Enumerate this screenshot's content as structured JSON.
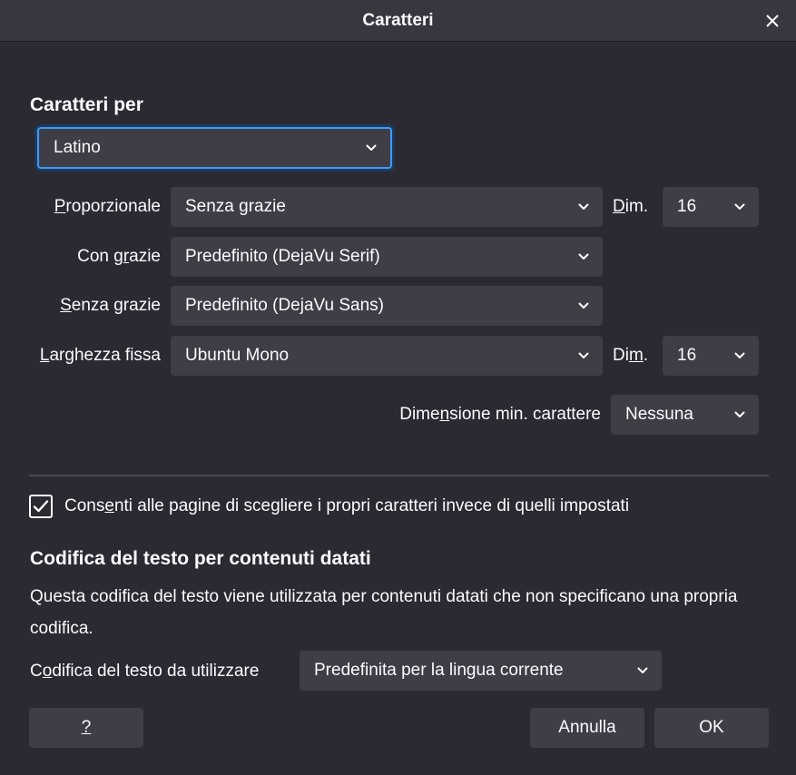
{
  "window": {
    "title": "Caratteri"
  },
  "fonts_for": {
    "heading": "Caratteri per",
    "script_value": "Latino"
  },
  "rows": {
    "proportional": {
      "label_pre": "",
      "label_acc": "P",
      "label_post": "roporzionale",
      "value": "Senza grazie",
      "size_label_pre": "",
      "size_label_acc": "D",
      "size_label_post": "im.",
      "size_value": "16"
    },
    "serif": {
      "label_pre": "Con g",
      "label_acc": "r",
      "label_post": "azie",
      "value": "Predefinito (DejaVu Serif)"
    },
    "sans": {
      "label_pre": "",
      "label_acc": "S",
      "label_post": "enza grazie",
      "value": "Predefinito (DejaVu Sans)"
    },
    "mono": {
      "label_pre": "",
      "label_acc": "L",
      "label_post": "arghezza fissa",
      "value": "Ubuntu Mono",
      "size_label_pre": "Di",
      "size_label_acc": "m",
      "size_label_post": ".",
      "size_value": "16"
    },
    "minsize": {
      "label_pre": "Dime",
      "label_acc": "n",
      "label_post": "sione min. carattere",
      "value": "Nessuna"
    }
  },
  "allow_pages": {
    "checked": true,
    "label_pre": "Cons",
    "label_acc": "e",
    "label_post": "nti alle pagine di scegliere i propri caratteri invece di quelli impostati"
  },
  "encoding": {
    "heading": "Codifica del testo per contenuti datati",
    "description": "Questa codifica del testo viene utilizzata per contenuti datati che non specificano una propria codifica.",
    "label_pre": "C",
    "label_acc": "o",
    "label_post": "difica del testo da utilizzare",
    "value": "Predefinita per la lingua corrente"
  },
  "buttons": {
    "help": "?",
    "cancel": "Annulla",
    "ok": "OK"
  }
}
